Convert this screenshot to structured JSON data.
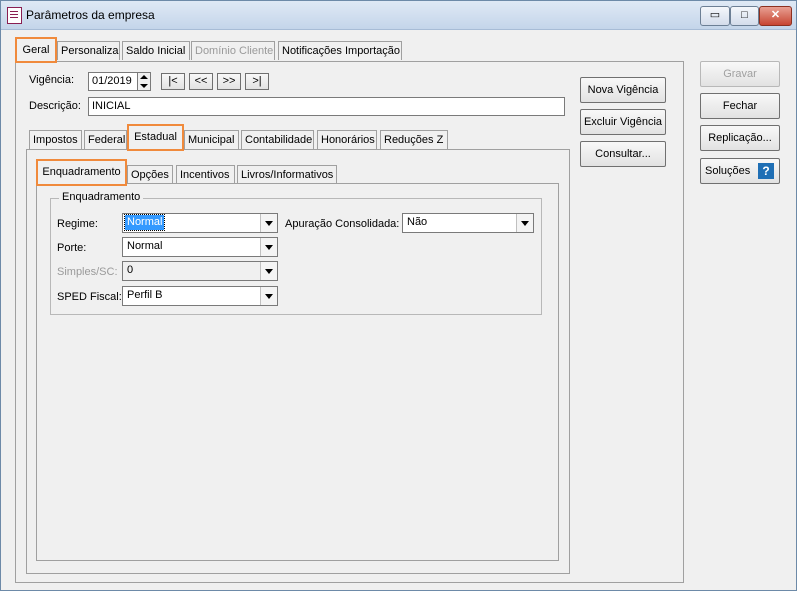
{
  "window": {
    "title": "Parâmetros da empresa",
    "minimize": "▭",
    "maximize": "□",
    "close": "✕"
  },
  "main_tabs": [
    "Geral",
    "Personaliza",
    "Saldo Inicial",
    "Domínio Cliente",
    "Notificações Importação"
  ],
  "vigencia": {
    "label": "Vigência:",
    "value": "01/2019",
    "nav": [
      "|<",
      "<<",
      ">>",
      ">|"
    ]
  },
  "descricao": {
    "label": "Descrição:",
    "value": "INICIAL"
  },
  "sub_tabs": [
    "Impostos",
    "Federal",
    "Estadual",
    "Municipal",
    "Contabilidade",
    "Honorários",
    "Reduções Z"
  ],
  "estadual_tabs": [
    "Enquadramento",
    "Opções",
    "Incentivos",
    "Livros/Informativos"
  ],
  "enquadramento": {
    "group_title": "Enquadramento",
    "regime": {
      "label": "Regime:",
      "value": "Normal"
    },
    "apuracao": {
      "label": "Apuração Consolidada:",
      "value": "Não"
    },
    "porte": {
      "label": "Porte:",
      "value": "Normal"
    },
    "simples": {
      "label": "Simples/SC:",
      "value": "0"
    },
    "sped": {
      "label": "SPED Fiscal:",
      "value": "Perfil B"
    }
  },
  "vigencia_buttons": [
    "Nova Vigência",
    "Excluir Vigência",
    "Consultar..."
  ],
  "side_buttons": {
    "gravar": "Gravar",
    "fechar": "Fechar",
    "replicacao": "Replicação...",
    "solucoes": "Soluções",
    "help_glyph": "?"
  },
  "colors": {
    "highlight": "#f08a3c",
    "selection": "#3399ff"
  }
}
